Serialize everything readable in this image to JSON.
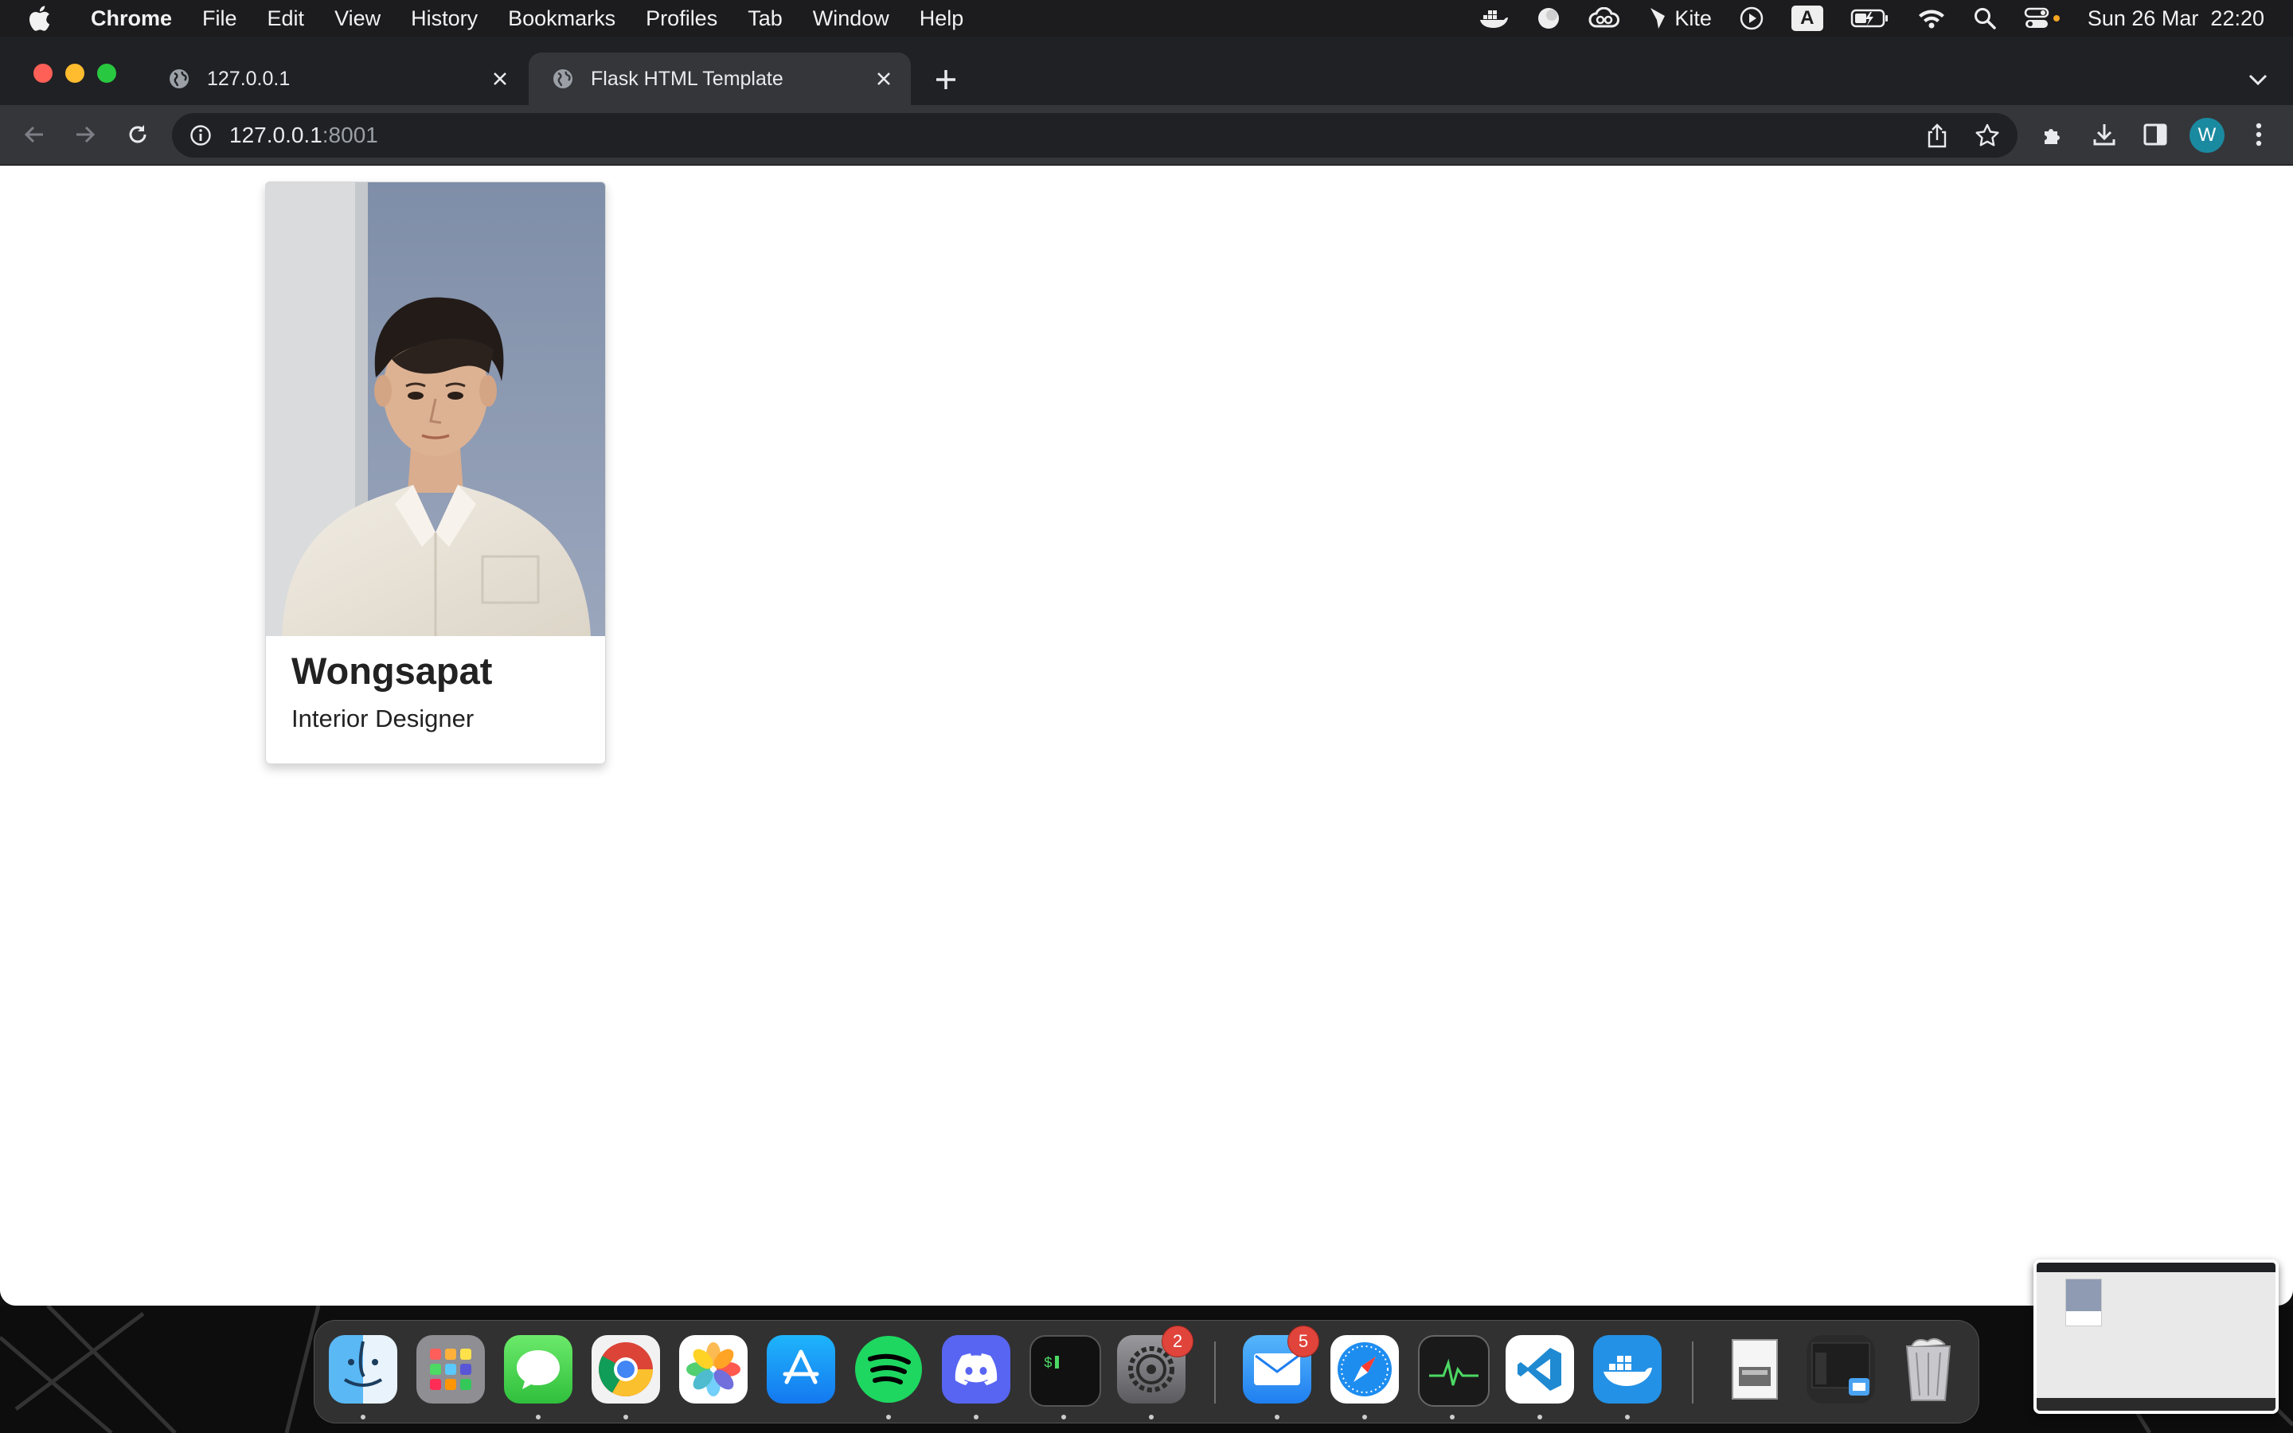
{
  "menubar": {
    "app_name": "Chrome",
    "items": [
      "File",
      "Edit",
      "View",
      "History",
      "Bookmarks",
      "Profiles",
      "Tab",
      "Window",
      "Help"
    ],
    "status": {
      "kite_label": "Kite",
      "input_source": "A",
      "datetime": "Sun 26 Mar  22:20"
    }
  },
  "browser": {
    "tabs": [
      {
        "title": "127.0.0.1",
        "active": false
      },
      {
        "title": "Flask HTML Template",
        "active": true
      }
    ],
    "url_host": "127.0.0.1",
    "url_port": ":8001",
    "profile_initial": "W",
    "accent": "#1a8aa0"
  },
  "page": {
    "card": {
      "name": "Wongsapat",
      "role": "Interior Designer"
    }
  },
  "dock": {
    "apps": [
      "finder-icon",
      "launchpad-icon",
      "messages-icon",
      "chrome-icon",
      "photos-icon",
      "app-store-icon",
      "spotify-icon",
      "discord-icon",
      "terminal-icon",
      "system-settings-icon",
      "mail-icon",
      "safari-icon",
      "activity-monitor-icon",
      "vscode-icon",
      "docker-icon",
      "preview-icon",
      "screenshot-icon",
      "trash-icon"
    ],
    "badges": {
      "settings": "2",
      "mail": "5"
    }
  }
}
